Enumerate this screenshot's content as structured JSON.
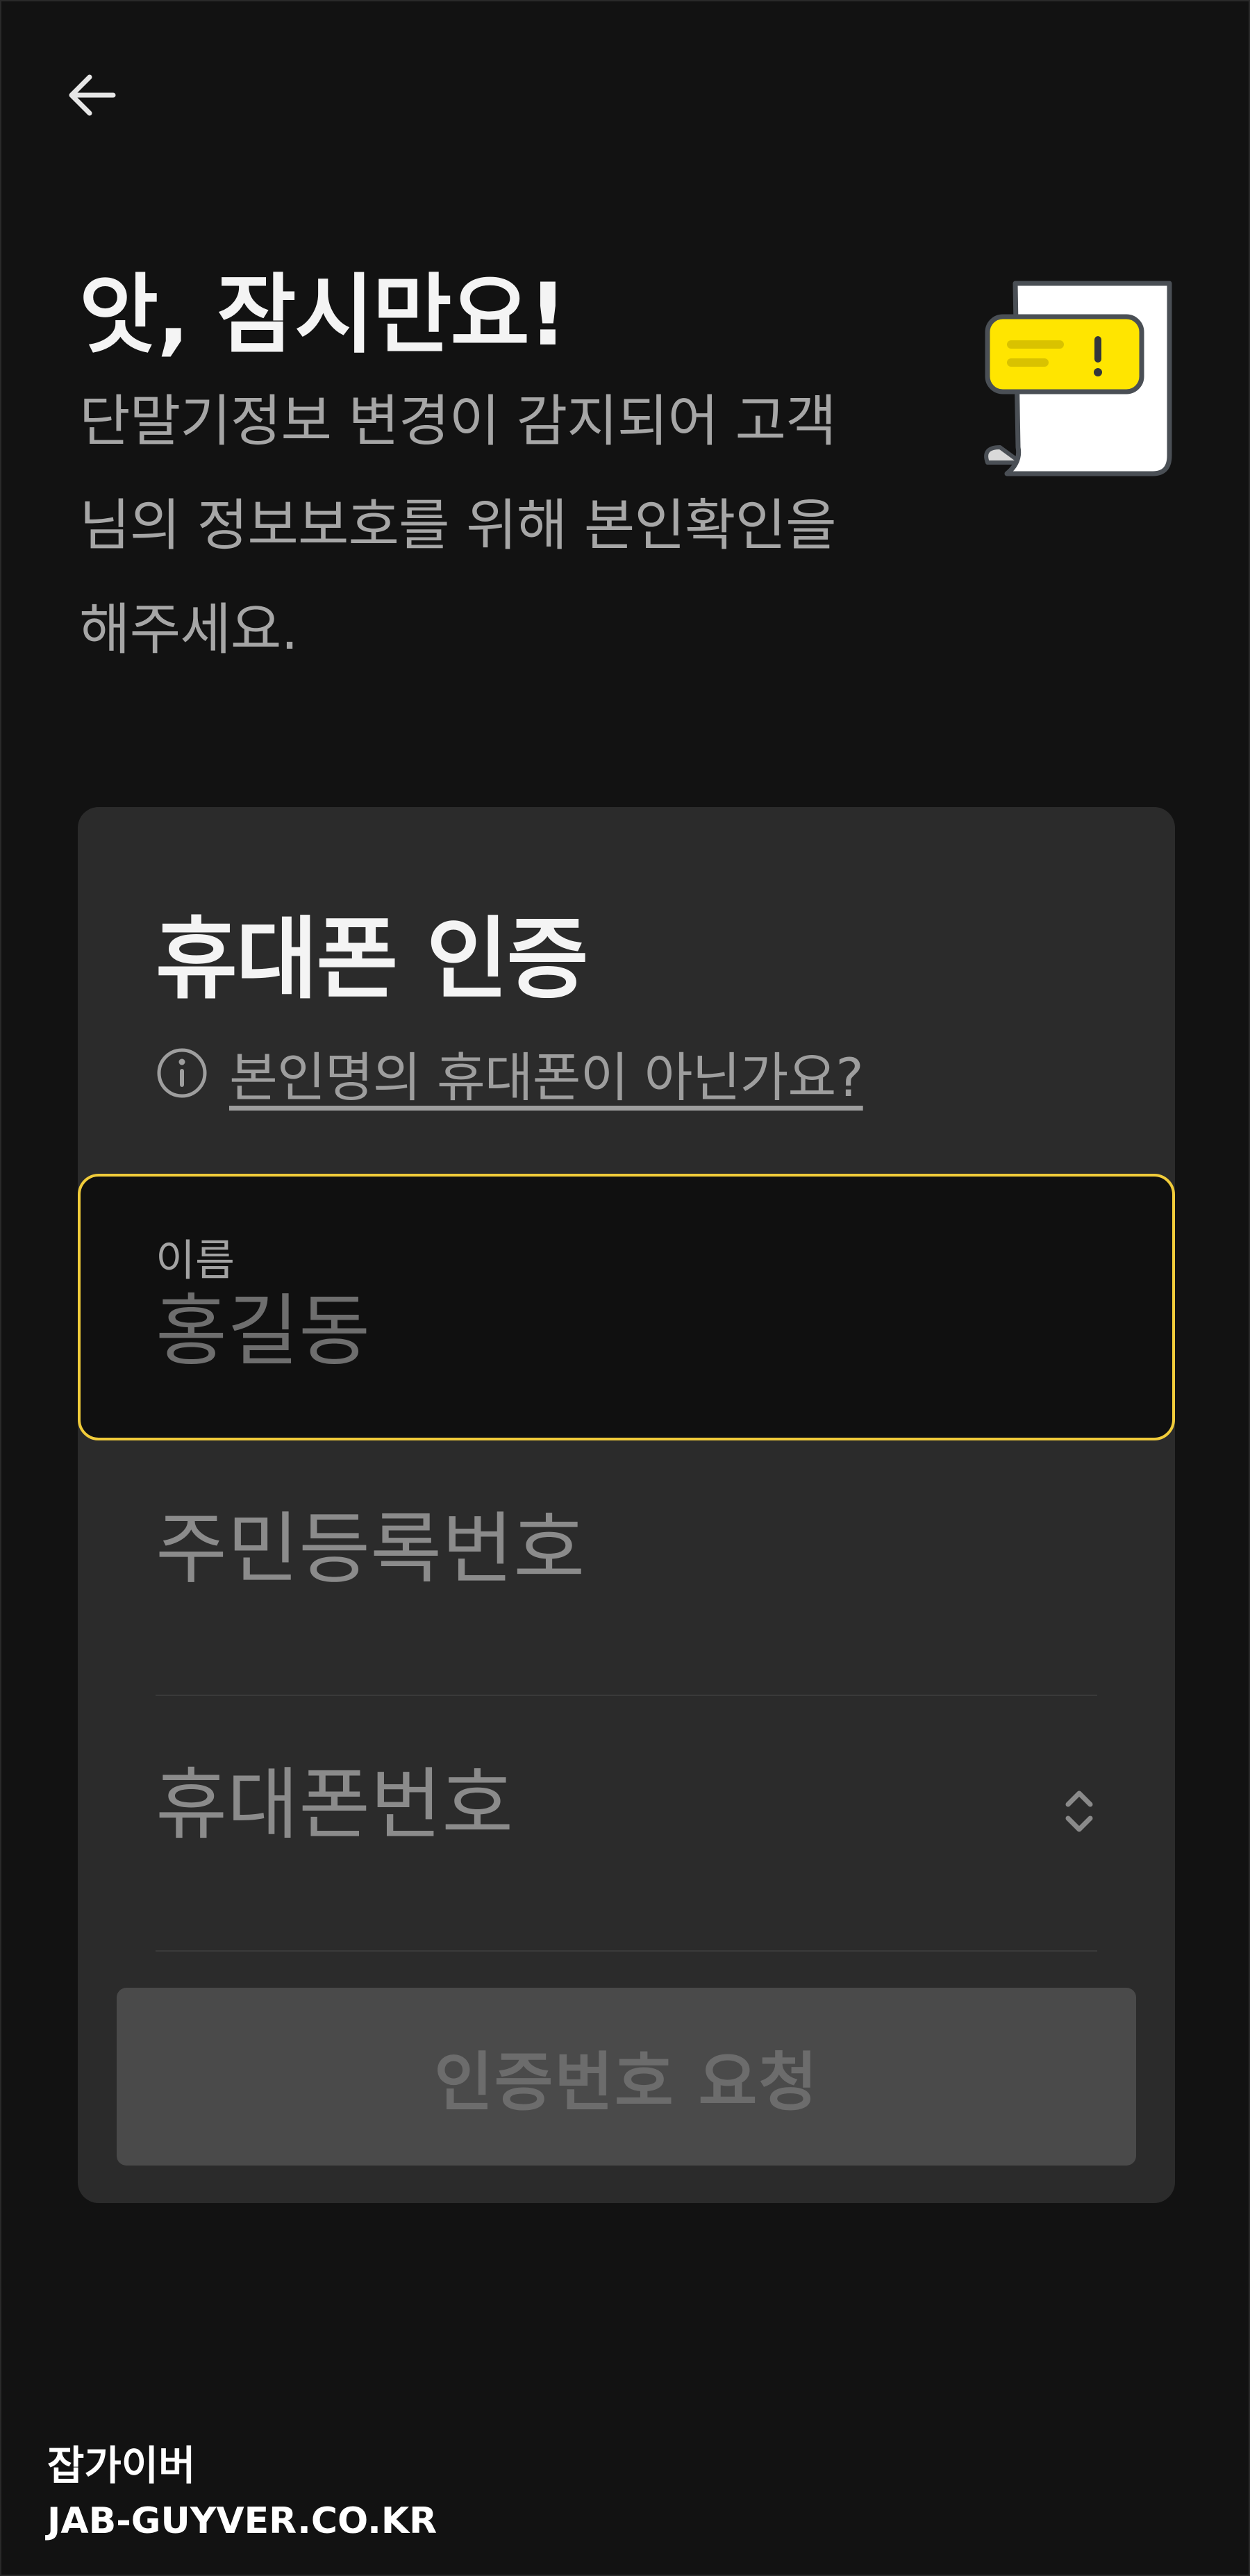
{
  "header": {
    "back_icon": "arrow-left-icon",
    "title": "앗, 잠시만요!",
    "description": "단말기정보 변경이 감지되어 고객님의 정보보호를 위해 본인확인을 해주세요.",
    "illustration_icon": "document-alert-icon"
  },
  "card": {
    "title": "휴대폰 인증",
    "help_icon": "info-icon",
    "help_link": "본인명의 휴대폰이 아닌가요?",
    "name_field": {
      "label": "이름",
      "placeholder": "홍길동",
      "value": ""
    },
    "rrn_field": {
      "placeholder": "주민등록번호",
      "value": ""
    },
    "phone_field": {
      "placeholder": "휴대폰번호",
      "value": "",
      "selector_icon": "chevron-up-down-icon"
    },
    "submit_label": "인증번호 요청"
  },
  "watermark": {
    "line1": "잡가이버",
    "line2": "JAB-GUYVER.CO.KR"
  },
  "colors": {
    "background": "#121212",
    "card": "#2b2b2b",
    "accent": "#f1cc3a",
    "disabled_button": "#4a4a4a"
  }
}
